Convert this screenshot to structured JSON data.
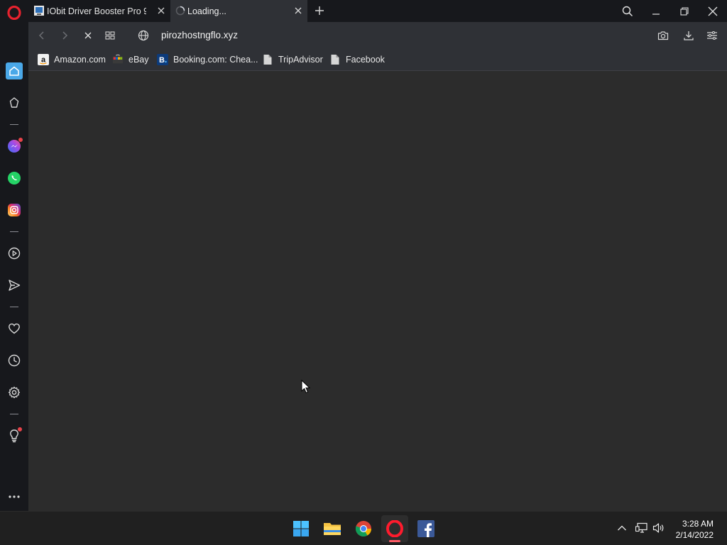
{
  "tabs": [
    {
      "title": "IObit Driver Booster Pro 9.",
      "state": "background"
    },
    {
      "title": "Loading...",
      "state": "active"
    }
  ],
  "address": {
    "url": "pirozhostngflo.xyz"
  },
  "bookmarks": [
    {
      "label": "Amazon.com",
      "icon": "amazon-icon"
    },
    {
      "label": "eBay",
      "icon": "ebay-icon"
    },
    {
      "label": "Booking.com: Chea...",
      "icon": "booking-icon"
    },
    {
      "label": "TripAdvisor",
      "icon": "page-icon"
    },
    {
      "label": "Facebook",
      "icon": "page-icon"
    }
  ],
  "taskbar": {
    "apps": [
      "windows-start-icon",
      "file-explorer-icon",
      "chrome-icon",
      "opera-icon",
      "facebook-icon"
    ],
    "time": "3:28 AM",
    "date": "2/14/2022"
  },
  "colors": {
    "accent": "#4aa8e8",
    "opera_red": "#e6222e",
    "page_bg": "#2c2c2c",
    "notification": "#e8434a"
  }
}
